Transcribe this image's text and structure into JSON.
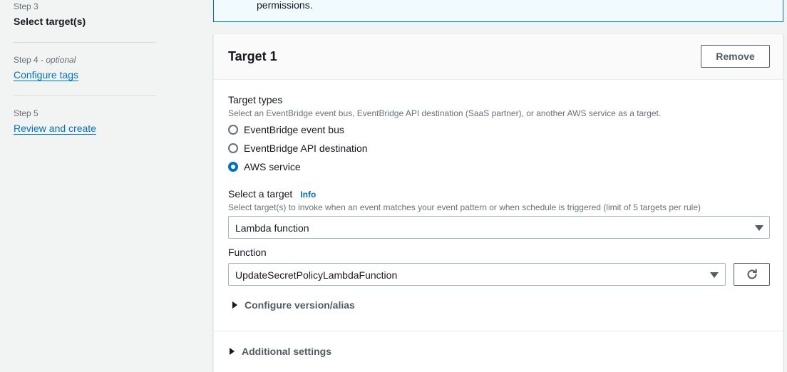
{
  "steps": [
    {
      "label": "Step 3",
      "optional": "",
      "title": "Select target(s)",
      "current": true
    },
    {
      "label": "Step 4 - ",
      "optional": "optional",
      "title": "Configure tags",
      "current": false
    },
    {
      "label": "Step 5",
      "optional": "",
      "title": "Review and create",
      "current": false
    }
  ],
  "info_box": {
    "text": "permissions."
  },
  "target": {
    "title": "Target 1",
    "remove_label": "Remove",
    "target_types": {
      "label": "Target types",
      "description": "Select an EventBridge event bus, EventBridge API destination (SaaS partner), or another AWS service as a target.",
      "options": [
        {
          "label": "EventBridge event bus",
          "checked": false
        },
        {
          "label": "EventBridge API destination",
          "checked": false
        },
        {
          "label": "AWS service",
          "checked": true
        }
      ]
    },
    "select_target": {
      "label": "Select a target",
      "info": "Info",
      "description": "Select target(s) to invoke when an event matches your event pattern or when schedule is triggered (limit of 5 targets per rule)",
      "value": "Lambda function"
    },
    "function": {
      "label": "Function",
      "value": "UpdateSecretPolicyLambdaFunction"
    },
    "configure_version": "Configure version/alias",
    "additional_settings": "Additional settings"
  },
  "icons": {
    "refresh": "refresh-icon",
    "caret": "caret-down-icon",
    "expand": "caret-right-icon"
  },
  "colors": {
    "accent": "#0073bb",
    "background": "#f2f3f3",
    "text": "#16191f",
    "muted": "#687078"
  }
}
